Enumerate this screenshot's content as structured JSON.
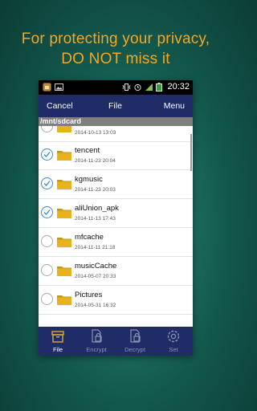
{
  "promo": {
    "line1": "For protecting your privacy,",
    "line2": "DO NOT miss it"
  },
  "statusbar": {
    "time": "20:32"
  },
  "appbar": {
    "left": "Cancel",
    "title": "File",
    "right": "Menu"
  },
  "path": "/mnt/sdcard",
  "files": [
    {
      "name": "",
      "date": "2014-10-13 13:03",
      "checked": false
    },
    {
      "name": "tencent",
      "date": "2014-11-23 20:04",
      "checked": true
    },
    {
      "name": "kgmusic",
      "date": "2014-11-23 20:03",
      "checked": true
    },
    {
      "name": "aliUnion_apk",
      "date": "2014-11-13 17:43",
      "checked": true
    },
    {
      "name": "mfcache",
      "date": "2014-11-11 21:18",
      "checked": false
    },
    {
      "name": "musicCache",
      "date": "2014-05-07 20:33",
      "checked": false
    },
    {
      "name": "Pictures",
      "date": "2014-05-31 16:32",
      "checked": false
    }
  ],
  "tabs": [
    {
      "label": "File",
      "icon": "file-tab-icon",
      "active": true
    },
    {
      "label": "Encrypt",
      "icon": "encrypt-tab-icon",
      "active": false
    },
    {
      "label": "Decrypt",
      "icon": "decrypt-tab-icon",
      "active": false
    },
    {
      "label": "Set",
      "icon": "settings-tab-icon",
      "active": false
    }
  ],
  "colors": {
    "accent": "#f5a623",
    "appbar": "#1f2c66",
    "check": "#3a8ad8",
    "folder": "#e8b21c"
  }
}
